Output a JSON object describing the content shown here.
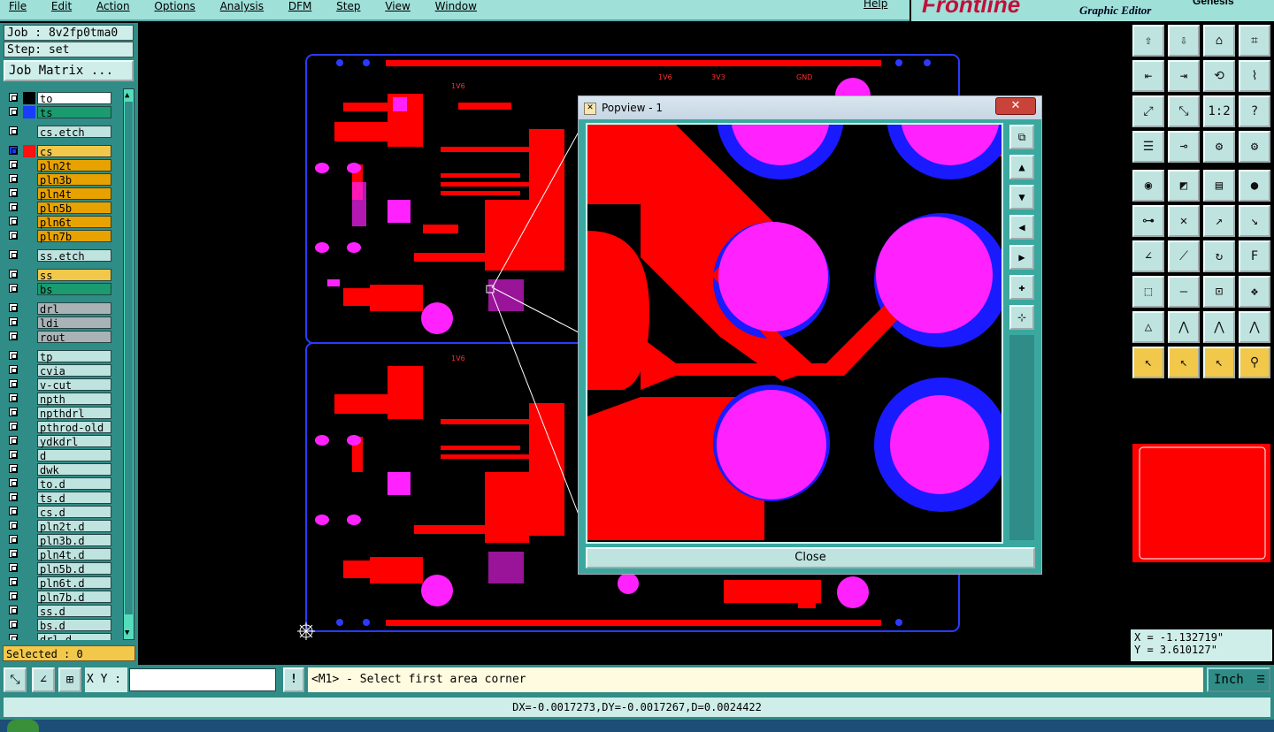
{
  "menubar": {
    "items": [
      "File",
      "Edit",
      "Action",
      "Options",
      "Analysis",
      "DFM",
      "Step",
      "View",
      "Window"
    ],
    "help": "Help"
  },
  "brand": {
    "logo": "Frontline",
    "subtitle": "Graphic Editor",
    "version": "Genesis"
  },
  "job": {
    "job_label": "Job : 8v2fp0tma0",
    "step_label": "Step: set",
    "matrix_button": "Job Matrix ..."
  },
  "layers": [
    {
      "name": "to",
      "color": "#ffffff",
      "swatch": "#000000"
    },
    {
      "name": "ts",
      "color": "#1a9b70",
      "swatch": "#1a3cff"
    },
    {
      "name": "cs.etch",
      "color": "#bfe4e0",
      "swatch": ""
    },
    {
      "name": "cs",
      "color": "#f2c84b",
      "swatch": "#ff1010",
      "active": true
    },
    {
      "name": "pln2t",
      "color": "#e8a200",
      "swatch": ""
    },
    {
      "name": "pln3b",
      "color": "#e8a200",
      "swatch": ""
    },
    {
      "name": "pln4t",
      "color": "#e8a200",
      "swatch": ""
    },
    {
      "name": "pln5b",
      "color": "#e8a200",
      "swatch": ""
    },
    {
      "name": "pln6t",
      "color": "#e8a200",
      "swatch": ""
    },
    {
      "name": "pln7b",
      "color": "#e8a200",
      "swatch": ""
    },
    {
      "name": "ss.etch",
      "color": "#bfe4e0",
      "swatch": ""
    },
    {
      "name": "ss",
      "color": "#f2c84b",
      "swatch": ""
    },
    {
      "name": "bs",
      "color": "#1a9b70",
      "swatch": ""
    },
    {
      "name": "drl",
      "color": "#a9b3b5",
      "swatch": ""
    },
    {
      "name": "ldi",
      "color": "#a9b3b5",
      "swatch": ""
    },
    {
      "name": "rout",
      "color": "#a9b3b5",
      "swatch": ""
    },
    {
      "name": "tp",
      "color": "#bfe4e0",
      "swatch": ""
    },
    {
      "name": "cvia",
      "color": "#bfe4e0",
      "swatch": ""
    },
    {
      "name": "v-cut",
      "color": "#bfe4e0",
      "swatch": ""
    },
    {
      "name": "npth",
      "color": "#bfe4e0",
      "swatch": ""
    },
    {
      "name": "npthdrl",
      "color": "#bfe4e0",
      "swatch": ""
    },
    {
      "name": "pthrod-old",
      "color": "#bfe4e0",
      "swatch": ""
    },
    {
      "name": "ydkdrl",
      "color": "#bfe4e0",
      "swatch": ""
    },
    {
      "name": "d",
      "color": "#bfe4e0",
      "swatch": ""
    },
    {
      "name": "dwk",
      "color": "#bfe4e0",
      "swatch": ""
    },
    {
      "name": "to.d",
      "color": "#bfe4e0",
      "swatch": ""
    },
    {
      "name": "ts.d",
      "color": "#bfe4e0",
      "swatch": ""
    },
    {
      "name": "cs.d",
      "color": "#bfe4e0",
      "swatch": ""
    },
    {
      "name": "pln2t.d",
      "color": "#bfe4e0",
      "swatch": ""
    },
    {
      "name": "pln3b.d",
      "color": "#bfe4e0",
      "swatch": ""
    },
    {
      "name": "pln4t.d",
      "color": "#bfe4e0",
      "swatch": ""
    },
    {
      "name": "pln5b.d",
      "color": "#bfe4e0",
      "swatch": ""
    },
    {
      "name": "pln6t.d",
      "color": "#bfe4e0",
      "swatch": ""
    },
    {
      "name": "pln7b.d",
      "color": "#bfe4e0",
      "swatch": ""
    },
    {
      "name": "ss.d",
      "color": "#bfe4e0",
      "swatch": ""
    },
    {
      "name": "bs.d",
      "color": "#bfe4e0",
      "swatch": ""
    },
    {
      "name": "drl.d",
      "color": "#bfe4e0",
      "swatch": ""
    }
  ],
  "selected_label": "Selected : 0",
  "board": {
    "labels": [
      "1V6",
      "1V6",
      "1V6",
      "3V3",
      "GND"
    ]
  },
  "popview": {
    "title": "Popview - 1",
    "close_label": "Close"
  },
  "coords": {
    "x": "X = -1.132719\"",
    "y": "Y = 3.610127\""
  },
  "cmd": {
    "xy_label": "X Y :",
    "xy_value": "",
    "bang": "!",
    "prompt": "<M1> - Select first area corner",
    "unit": "Inch"
  },
  "measure": "DX=-0.0017273,DY=-0.0017267,D=0.0024422",
  "colors": {
    "copper": "#ff0000",
    "pad": "#ff22ff",
    "mask": "#1a1aff",
    "panel": "#2f8c86"
  }
}
